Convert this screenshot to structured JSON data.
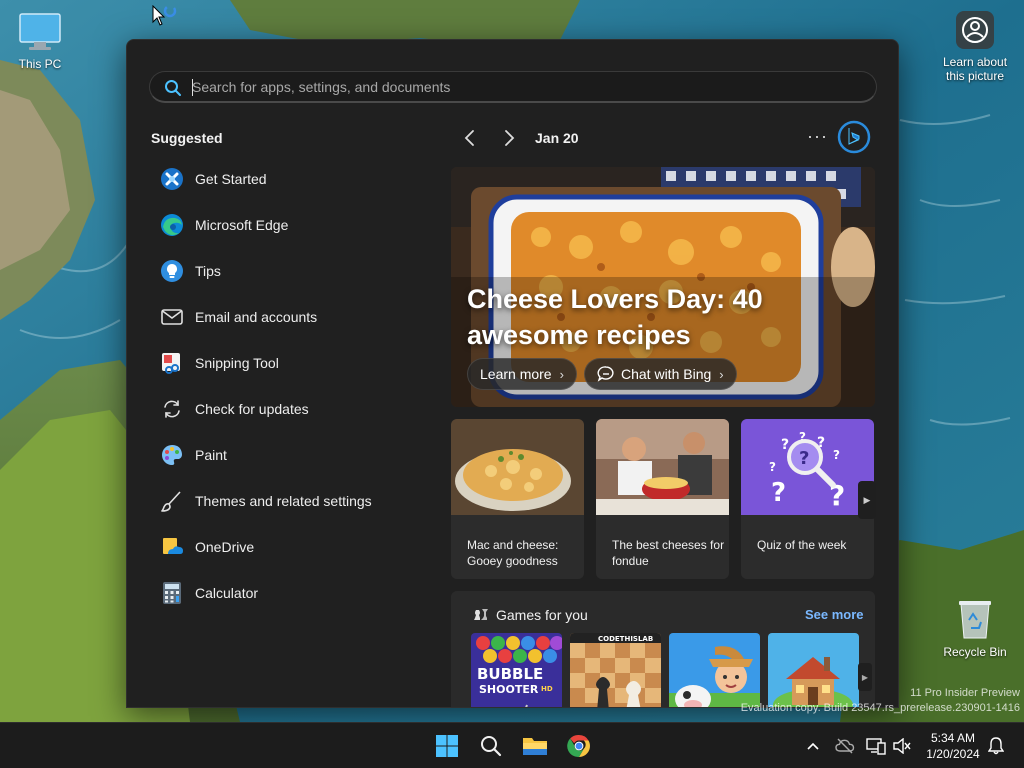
{
  "desktop": {
    "this_pc_label": "This PC",
    "learn_label": "Learn about this picture",
    "recycle_label": "Recycle Bin"
  },
  "search": {
    "placeholder": "Search for apps, settings, and documents",
    "value": ""
  },
  "suggested": {
    "title": "Suggested",
    "items": [
      {
        "label": "Get Started",
        "icon": "get-started-icon"
      },
      {
        "label": "Microsoft Edge",
        "icon": "edge-icon"
      },
      {
        "label": "Tips",
        "icon": "tips-icon"
      },
      {
        "label": "Email and accounts",
        "icon": "email-icon"
      },
      {
        "label": "Snipping Tool",
        "icon": "snipping-tool-icon"
      },
      {
        "label": "Check for updates",
        "icon": "update-icon"
      },
      {
        "label": "Paint",
        "icon": "paint-icon"
      },
      {
        "label": "Themes and related settings",
        "icon": "brush-icon"
      },
      {
        "label": "OneDrive",
        "icon": "onedrive-icon"
      },
      {
        "label": "Calculator",
        "icon": "calculator-icon"
      }
    ]
  },
  "widgets": {
    "date": "Jan 20",
    "more": "···",
    "hero": {
      "title": "Cheese Lovers Day: 40 awesome recipes",
      "learn_more": "Learn more",
      "chat": "Chat with Bing"
    },
    "cards": [
      {
        "title": "Mac and cheese: Gooey goodness"
      },
      {
        "title": "The best cheeses for fondue"
      },
      {
        "title": "Quiz of the week"
      }
    ],
    "games": {
      "title": "Games for you",
      "see_more": "See more",
      "tiles": [
        {
          "name": "BUBBLE SHOOTER",
          "badge": "HD"
        },
        {
          "name": "CODETHISLAB"
        },
        {
          "name": ""
        },
        {
          "name": ""
        }
      ]
    }
  },
  "watermark": {
    "line1": "11 Pro Insider Preview",
    "line2": "Evaluation copy. Build 23547.rs_prerelease.230901-1416"
  },
  "taskbar": {
    "time": "5:34 AM",
    "date": "1/20/2024"
  },
  "colors": {
    "accent": "#4cc2ff",
    "link": "#7ab8ff",
    "panel": "#202020"
  }
}
